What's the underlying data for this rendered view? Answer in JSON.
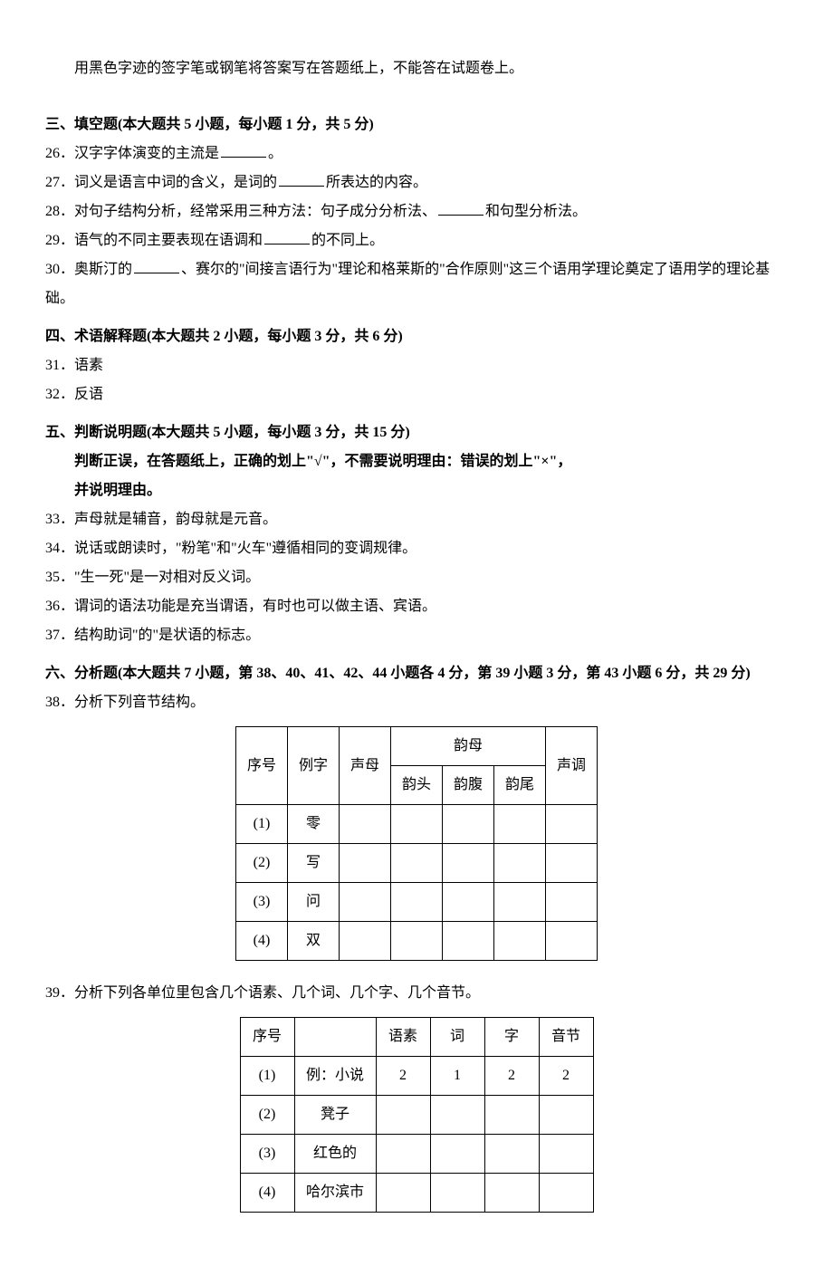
{
  "instruction": "用黑色字迹的签字笔或钢笔将答案写在答题纸上，不能答在试题卷上。",
  "section3": {
    "title": "三、填空题(本大题共 5 小题，每小题 1 分，共 5 分)",
    "q26_prefix": "26．汉字字体演变的主流是",
    "q26_suffix": "。",
    "q27_prefix": "27．词义是语言中词的含义，是词的",
    "q27_suffix": "所表达的内容。",
    "q28_prefix": "28．对句子结构分析，经常采用三种方法：句子成分分析法、",
    "q28_suffix": "和句型分析法。",
    "q29_prefix": "29．语气的不同主要表现在语调和",
    "q29_suffix": "的不同上。",
    "q30_prefix": "30．奥斯汀的",
    "q30_suffix": "、赛尔的\"间接言语行为\"理论和格莱斯的\"合作原则\"这三个语用学理论奠定了语用学的理论基础。"
  },
  "section4": {
    "title": "四、术语解释题(本大题共 2 小题，每小题 3 分，共 6 分)",
    "q31": "31．语素",
    "q32": "32．反语"
  },
  "section5": {
    "title": "五、判断说明题(本大题共 5 小题，每小题 3 分，共 15 分)",
    "inst1": "判断正误，在答题纸上，正确的划上\"√\"，不需要说明理由：错误的划上\"×\"，",
    "inst2": "并说明理由。",
    "q33": "33．声母就是辅音，韵母就是元音。",
    "q34": "34．说话或朗读时，\"粉笔\"和\"火车\"遵循相同的变调规律。",
    "q35": "35．\"生一死\"是一对相对反义词。",
    "q36": "36．谓词的语法功能是充当谓语，有时也可以做主语、宾语。",
    "q37": "37．结构助词\"的\"是状语的标志。"
  },
  "section6": {
    "title": "六、分析题(本大题共 7 小题，第 38、40、41、42、44 小题各 4 分，第 39 小题 3 分，第 43 小题 6 分，共 29 分)",
    "q38": "38．分析下列音节结构。",
    "q39": "39．分析下列各单位里包含几个语素、几个词、几个字、几个音节。"
  },
  "table1": {
    "h_xuhao": "序号",
    "h_lizi": "例字",
    "h_shengmu": "声母",
    "h_yunmu": "韵母",
    "h_yuntou": "韵头",
    "h_yunfu": "韵腹",
    "h_yunwei": "韵尾",
    "h_shengdiao": "声调",
    "rows": [
      {
        "n": "(1)",
        "c": "零"
      },
      {
        "n": "(2)",
        "c": "写"
      },
      {
        "n": "(3)",
        "c": "问"
      },
      {
        "n": "(4)",
        "c": "双"
      }
    ]
  },
  "table2": {
    "h_xuhao": "序号",
    "h_blank": "",
    "h_yusu": "语素",
    "h_ci": "词",
    "h_zi": "字",
    "h_yinjie": "音节",
    "rows": [
      {
        "n": "(1)",
        "text": "例：小说",
        "yusu": "2",
        "ci": "1",
        "zi": "2",
        "yinjie": "2"
      },
      {
        "n": "(2)",
        "text": "凳子",
        "yusu": "",
        "ci": "",
        "zi": "",
        "yinjie": ""
      },
      {
        "n": "(3)",
        "text": "红色的",
        "yusu": "",
        "ci": "",
        "zi": "",
        "yinjie": ""
      },
      {
        "n": "(4)",
        "text": "哈尔滨市",
        "yusu": "",
        "ci": "",
        "zi": "",
        "yinjie": ""
      }
    ]
  }
}
